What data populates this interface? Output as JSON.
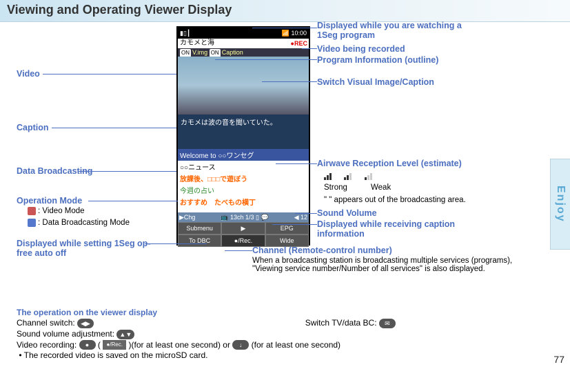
{
  "page": {
    "title": "Viewing and Operating Viewer Display",
    "tab": "Enjoy",
    "number": "77"
  },
  "left_labels": {
    "video": "Video",
    "caption": "Caption",
    "data_bc": "Data Broadcasting",
    "op_mode": "Operation Mode",
    "op_video": ": Video Mode",
    "op_data": ": Data Broadcasting Mode",
    "autooff": "Displayed while setting 1Seg op-free auto off"
  },
  "right_labels": {
    "watching": "Displayed while you are watching a 1Seg program",
    "recording": "Video being recorded",
    "proginfo": "Program Information (outline)",
    "switchvc": "Switch Visual Image/Caption",
    "airwave": "Airwave Reception Level (estimate)",
    "strong": "Strong",
    "weak": "Weak",
    "out_area": "\"      \" appears out of the broadcasting area.",
    "volume": "Sound Volume",
    "capinfo": "Displayed while receiving caption information",
    "channel": "Channel (Remote-control number)",
    "channel_sub": "When a broadcasting station is broadcasting multiple services (programs), \"Viewing service number/Number of all services\" is also displayed."
  },
  "phone": {
    "status_left": "▮▯┃",
    "status_right": "📶 10:00",
    "prog_title": "カモメと海",
    "rec": "●REC",
    "sub_on1": "ON",
    "sub_vimg": "V.img",
    "sub_on2": "ON",
    "sub_cap": "Caption",
    "caption_text": "カモメは波の音を聞いていた。",
    "welcome": "Welcome to ○○ワンセグ",
    "d1": "○○ニュース",
    "d2": "放課後、□□□で遊ぼう",
    "d3": "今週の占い",
    "d4": "おすすめ　たべもの横丁",
    "ind_left": "▶Chg",
    "ind_mid": "📺 13ch 1/3 ▯ 💬",
    "ind_right": "◀ 12",
    "sk1": "Submenu",
    "sk2": "▶",
    "sk3": "EPG",
    "sk4": "To DBC",
    "sk5": "●/Rec.",
    "sk6": "Wide"
  },
  "bottom": {
    "heading": "The operation on the viewer display",
    "ch_switch": "Channel switch: ",
    "tvdata": "Switch TV/data BC: ",
    "vol": "Sound volume adjustment: ",
    "rec": "Video recording: ",
    "rec_paren1": "(",
    "rec_btn": "●/Rec.",
    "rec_paren2": ")(for at least one second) or ",
    "rec_tail": "(for at least one second)",
    "note": "The recorded video is saved on the microSD card."
  }
}
